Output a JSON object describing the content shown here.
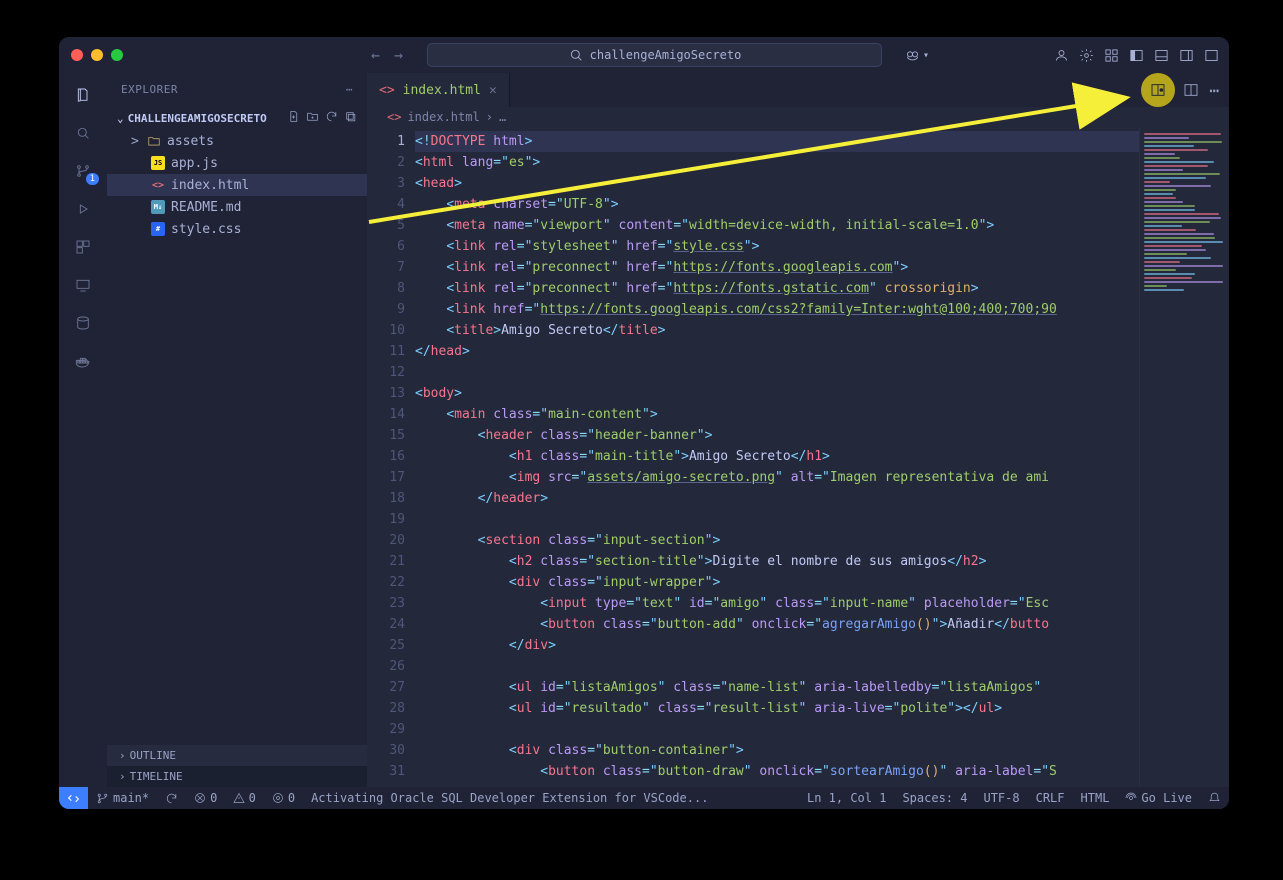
{
  "title": "challengeAmigoSecreto",
  "traffic": [
    "close",
    "min",
    "zoom"
  ],
  "sidebar": {
    "header": "EXPLORER",
    "project": "CHALLENGEAMIGOSECRETO",
    "tree": [
      {
        "kind": "folder",
        "chev": ">",
        "label": "assets",
        "icon": "folder"
      },
      {
        "kind": "file",
        "label": "app.js",
        "icon": "js"
      },
      {
        "kind": "file",
        "label": "index.html",
        "icon": "html",
        "selected": true
      },
      {
        "kind": "file",
        "label": "README.md",
        "icon": "md"
      },
      {
        "kind": "file",
        "label": "style.css",
        "icon": "css"
      }
    ],
    "outline": "OUTLINE",
    "timeline": "TIMELINE"
  },
  "tab": {
    "label": "index.html"
  },
  "breadcrumb": [
    "index.html",
    "…"
  ],
  "activity_badge": "1",
  "code_lines_count": 31,
  "code": [
    {
      "hl": true,
      "tokens": [
        [
          "p",
          "<!"
        ],
        [
          "t",
          "DOCTYPE"
        ],
        [
          "txt",
          " "
        ],
        [
          "a",
          "html"
        ],
        [
          "p",
          ">"
        ]
      ]
    },
    {
      "tokens": [
        [
          "p",
          "<"
        ],
        [
          "t",
          "html"
        ],
        [
          "txt",
          " "
        ],
        [
          "a",
          "lang"
        ],
        [
          "op",
          "="
        ],
        [
          "p",
          "\""
        ],
        [
          "s",
          "es"
        ],
        [
          "p",
          "\""
        ],
        [
          "p",
          ">"
        ]
      ]
    },
    {
      "tokens": [
        [
          "p",
          "<"
        ],
        [
          "t",
          "head"
        ],
        [
          "p",
          ">"
        ]
      ]
    },
    {
      "indent": 1,
      "tokens": [
        [
          "p",
          "<"
        ],
        [
          "t",
          "meta"
        ],
        [
          "txt",
          " "
        ],
        [
          "a",
          "charset"
        ],
        [
          "op",
          "="
        ],
        [
          "p",
          "\""
        ],
        [
          "s",
          "UTF-8"
        ],
        [
          "p",
          "\""
        ],
        [
          "p",
          ">"
        ]
      ]
    },
    {
      "indent": 1,
      "tokens": [
        [
          "p",
          "<"
        ],
        [
          "t",
          "meta"
        ],
        [
          "txt",
          " "
        ],
        [
          "a",
          "name"
        ],
        [
          "op",
          "="
        ],
        [
          "p",
          "\""
        ],
        [
          "s",
          "viewport"
        ],
        [
          "p",
          "\""
        ],
        [
          "txt",
          " "
        ],
        [
          "a",
          "content"
        ],
        [
          "op",
          "="
        ],
        [
          "p",
          "\""
        ],
        [
          "s",
          "width=device-width, initial-scale=1.0"
        ],
        [
          "p",
          "\""
        ],
        [
          "p",
          ">"
        ]
      ]
    },
    {
      "indent": 1,
      "tokens": [
        [
          "p",
          "<"
        ],
        [
          "t",
          "link"
        ],
        [
          "txt",
          " "
        ],
        [
          "a",
          "rel"
        ],
        [
          "op",
          "="
        ],
        [
          "p",
          "\""
        ],
        [
          "s",
          "stylesheet"
        ],
        [
          "p",
          "\""
        ],
        [
          "txt",
          " "
        ],
        [
          "a",
          "href"
        ],
        [
          "op",
          "="
        ],
        [
          "p",
          "\""
        ],
        [
          "su",
          "style.css"
        ],
        [
          "p",
          "\""
        ],
        [
          "p",
          ">"
        ]
      ]
    },
    {
      "indent": 1,
      "tokens": [
        [
          "p",
          "<"
        ],
        [
          "t",
          "link"
        ],
        [
          "txt",
          " "
        ],
        [
          "a",
          "rel"
        ],
        [
          "op",
          "="
        ],
        [
          "p",
          "\""
        ],
        [
          "s",
          "preconnect"
        ],
        [
          "p",
          "\""
        ],
        [
          "txt",
          " "
        ],
        [
          "a",
          "href"
        ],
        [
          "op",
          "="
        ],
        [
          "p",
          "\""
        ],
        [
          "su",
          "https://fonts.googleapis.com"
        ],
        [
          "p",
          "\""
        ],
        [
          "p",
          ">"
        ]
      ]
    },
    {
      "indent": 1,
      "tokens": [
        [
          "p",
          "<"
        ],
        [
          "t",
          "link"
        ],
        [
          "txt",
          " "
        ],
        [
          "a",
          "rel"
        ],
        [
          "op",
          "="
        ],
        [
          "p",
          "\""
        ],
        [
          "s",
          "preconnect"
        ],
        [
          "p",
          "\""
        ],
        [
          "txt",
          " "
        ],
        [
          "a",
          "href"
        ],
        [
          "op",
          "="
        ],
        [
          "p",
          "\""
        ],
        [
          "su",
          "https://fonts.gstatic.com"
        ],
        [
          "p",
          "\""
        ],
        [
          "txt",
          " "
        ],
        [
          "c",
          "crossorigin"
        ],
        [
          "p",
          ">"
        ]
      ]
    },
    {
      "indent": 1,
      "tokens": [
        [
          "p",
          "<"
        ],
        [
          "t",
          "link"
        ],
        [
          "txt",
          " "
        ],
        [
          "a",
          "href"
        ],
        [
          "op",
          "="
        ],
        [
          "p",
          "\""
        ],
        [
          "su",
          "https://fonts.googleapis.com/css2?family=Inter:wght@100;400;700;90"
        ]
      ]
    },
    {
      "indent": 1,
      "tokens": [
        [
          "p",
          "<"
        ],
        [
          "t",
          "title"
        ],
        [
          "p",
          ">"
        ],
        [
          "txt",
          "Amigo Secreto"
        ],
        [
          "p",
          "</"
        ],
        [
          "t",
          "title"
        ],
        [
          "p",
          ">"
        ]
      ]
    },
    {
      "tokens": [
        [
          "p",
          "</"
        ],
        [
          "t",
          "head"
        ],
        [
          "p",
          ">"
        ]
      ]
    },
    {
      "tokens": []
    },
    {
      "tokens": [
        [
          "p",
          "<"
        ],
        [
          "t",
          "body"
        ],
        [
          "p",
          ">"
        ]
      ]
    },
    {
      "indent": 1,
      "tokens": [
        [
          "p",
          "<"
        ],
        [
          "t",
          "main"
        ],
        [
          "txt",
          " "
        ],
        [
          "a",
          "class"
        ],
        [
          "op",
          "="
        ],
        [
          "p",
          "\""
        ],
        [
          "s",
          "main-content"
        ],
        [
          "p",
          "\""
        ],
        [
          "p",
          ">"
        ]
      ]
    },
    {
      "indent": 2,
      "tokens": [
        [
          "p",
          "<"
        ],
        [
          "t",
          "header"
        ],
        [
          "txt",
          " "
        ],
        [
          "a",
          "class"
        ],
        [
          "op",
          "="
        ],
        [
          "p",
          "\""
        ],
        [
          "s",
          "header-banner"
        ],
        [
          "p",
          "\""
        ],
        [
          "p",
          ">"
        ]
      ]
    },
    {
      "indent": 3,
      "tokens": [
        [
          "p",
          "<"
        ],
        [
          "t",
          "h1"
        ],
        [
          "txt",
          " "
        ],
        [
          "a",
          "class"
        ],
        [
          "op",
          "="
        ],
        [
          "p",
          "\""
        ],
        [
          "s",
          "main-title"
        ],
        [
          "p",
          "\""
        ],
        [
          "p",
          ">"
        ],
        [
          "txt",
          "Amigo Secreto"
        ],
        [
          "p",
          "</"
        ],
        [
          "t",
          "h1"
        ],
        [
          "p",
          ">"
        ]
      ]
    },
    {
      "indent": 3,
      "tokens": [
        [
          "p",
          "<"
        ],
        [
          "t",
          "img"
        ],
        [
          "txt",
          " "
        ],
        [
          "a",
          "src"
        ],
        [
          "op",
          "="
        ],
        [
          "p",
          "\""
        ],
        [
          "su",
          "assets/amigo-secreto.png"
        ],
        [
          "p",
          "\""
        ],
        [
          "txt",
          " "
        ],
        [
          "a",
          "alt"
        ],
        [
          "op",
          "="
        ],
        [
          "p",
          "\""
        ],
        [
          "s",
          "Imagen representativa de ami"
        ]
      ]
    },
    {
      "indent": 2,
      "tokens": [
        [
          "p",
          "</"
        ],
        [
          "t",
          "header"
        ],
        [
          "p",
          ">"
        ]
      ]
    },
    {
      "tokens": []
    },
    {
      "indent": 2,
      "tokens": [
        [
          "p",
          "<"
        ],
        [
          "t",
          "section"
        ],
        [
          "txt",
          " "
        ],
        [
          "a",
          "class"
        ],
        [
          "op",
          "="
        ],
        [
          "p",
          "\""
        ],
        [
          "s",
          "input-section"
        ],
        [
          "p",
          "\""
        ],
        [
          "p",
          ">"
        ]
      ]
    },
    {
      "indent": 3,
      "tokens": [
        [
          "p",
          "<"
        ],
        [
          "t",
          "h2"
        ],
        [
          "txt",
          " "
        ],
        [
          "a",
          "class"
        ],
        [
          "op",
          "="
        ],
        [
          "p",
          "\""
        ],
        [
          "s",
          "section-title"
        ],
        [
          "p",
          "\""
        ],
        [
          "p",
          ">"
        ],
        [
          "txt",
          "Digite el nombre de sus amigos"
        ],
        [
          "p",
          "</"
        ],
        [
          "t",
          "h2"
        ],
        [
          "p",
          ">"
        ]
      ]
    },
    {
      "indent": 3,
      "tokens": [
        [
          "p",
          "<"
        ],
        [
          "t",
          "div"
        ],
        [
          "txt",
          " "
        ],
        [
          "a",
          "class"
        ],
        [
          "op",
          "="
        ],
        [
          "p",
          "\""
        ],
        [
          "s",
          "input-wrapper"
        ],
        [
          "p",
          "\""
        ],
        [
          "p",
          ">"
        ]
      ]
    },
    {
      "indent": 4,
      "tokens": [
        [
          "p",
          "<"
        ],
        [
          "t",
          "input"
        ],
        [
          "txt",
          " "
        ],
        [
          "a",
          "type"
        ],
        [
          "op",
          "="
        ],
        [
          "p",
          "\""
        ],
        [
          "s",
          "text"
        ],
        [
          "p",
          "\""
        ],
        [
          "txt",
          " "
        ],
        [
          "a",
          "id"
        ],
        [
          "op",
          "="
        ],
        [
          "p",
          "\""
        ],
        [
          "s",
          "amigo"
        ],
        [
          "p",
          "\""
        ],
        [
          "txt",
          " "
        ],
        [
          "a",
          "class"
        ],
        [
          "op",
          "="
        ],
        [
          "p",
          "\""
        ],
        [
          "s",
          "input-name"
        ],
        [
          "p",
          "\""
        ],
        [
          "txt",
          " "
        ],
        [
          "a",
          "placeholder"
        ],
        [
          "op",
          "="
        ],
        [
          "p",
          "\""
        ],
        [
          "s",
          "Esc"
        ]
      ]
    },
    {
      "indent": 4,
      "tokens": [
        [
          "p",
          "<"
        ],
        [
          "t",
          "button"
        ],
        [
          "txt",
          " "
        ],
        [
          "a",
          "class"
        ],
        [
          "op",
          "="
        ],
        [
          "p",
          "\""
        ],
        [
          "s",
          "button-add"
        ],
        [
          "p",
          "\""
        ],
        [
          "txt",
          " "
        ],
        [
          "a",
          "onclick"
        ],
        [
          "op",
          "="
        ],
        [
          "p",
          "\""
        ],
        [
          "fn",
          "agregarAmigo"
        ],
        [
          "c",
          "()"
        ],
        [
          "p",
          "\""
        ],
        [
          "p",
          ">"
        ],
        [
          "txt",
          "Añadir"
        ],
        [
          "p",
          "</"
        ],
        [
          "t",
          "butto"
        ]
      ]
    },
    {
      "indent": 3,
      "tokens": [
        [
          "p",
          "</"
        ],
        [
          "t",
          "div"
        ],
        [
          "p",
          ">"
        ]
      ]
    },
    {
      "tokens": []
    },
    {
      "indent": 3,
      "tokens": [
        [
          "p",
          "<"
        ],
        [
          "t",
          "ul"
        ],
        [
          "txt",
          " "
        ],
        [
          "a",
          "id"
        ],
        [
          "op",
          "="
        ],
        [
          "p",
          "\""
        ],
        [
          "s",
          "listaAmigos"
        ],
        [
          "p",
          "\""
        ],
        [
          "txt",
          " "
        ],
        [
          "a",
          "class"
        ],
        [
          "op",
          "="
        ],
        [
          "p",
          "\""
        ],
        [
          "s",
          "name-list"
        ],
        [
          "p",
          "\""
        ],
        [
          "txt",
          " "
        ],
        [
          "a",
          "aria-labelledby"
        ],
        [
          "op",
          "="
        ],
        [
          "p",
          "\""
        ],
        [
          "s",
          "listaAmigos"
        ],
        [
          "p",
          "\""
        ]
      ]
    },
    {
      "indent": 3,
      "tokens": [
        [
          "p",
          "<"
        ],
        [
          "t",
          "ul"
        ],
        [
          "txt",
          " "
        ],
        [
          "a",
          "id"
        ],
        [
          "op",
          "="
        ],
        [
          "p",
          "\""
        ],
        [
          "s",
          "resultado"
        ],
        [
          "p",
          "\""
        ],
        [
          "txt",
          " "
        ],
        [
          "a",
          "class"
        ],
        [
          "op",
          "="
        ],
        [
          "p",
          "\""
        ],
        [
          "s",
          "result-list"
        ],
        [
          "p",
          "\""
        ],
        [
          "txt",
          " "
        ],
        [
          "a",
          "aria-live"
        ],
        [
          "op",
          "="
        ],
        [
          "p",
          "\""
        ],
        [
          "s",
          "polite"
        ],
        [
          "p",
          "\""
        ],
        [
          "p",
          "></"
        ],
        [
          "t",
          "ul"
        ],
        [
          "p",
          ">"
        ]
      ]
    },
    {
      "tokens": []
    },
    {
      "indent": 3,
      "tokens": [
        [
          "p",
          "<"
        ],
        [
          "t",
          "div"
        ],
        [
          "txt",
          " "
        ],
        [
          "a",
          "class"
        ],
        [
          "op",
          "="
        ],
        [
          "p",
          "\""
        ],
        [
          "s",
          "button-container"
        ],
        [
          "p",
          "\""
        ],
        [
          "p",
          ">"
        ]
      ]
    },
    {
      "indent": 4,
      "tokens": [
        [
          "p",
          "<"
        ],
        [
          "t",
          "button"
        ],
        [
          "txt",
          " "
        ],
        [
          "a",
          "class"
        ],
        [
          "op",
          "="
        ],
        [
          "p",
          "\""
        ],
        [
          "s",
          "button-draw"
        ],
        [
          "p",
          "\""
        ],
        [
          "txt",
          " "
        ],
        [
          "a",
          "onclick"
        ],
        [
          "op",
          "="
        ],
        [
          "p",
          "\""
        ],
        [
          "fn",
          "sortearAmigo"
        ],
        [
          "c",
          "()"
        ],
        [
          "p",
          "\""
        ],
        [
          "txt",
          " "
        ],
        [
          "a",
          "aria-label"
        ],
        [
          "op",
          "="
        ],
        [
          "p",
          "\""
        ],
        [
          "s",
          "S"
        ]
      ]
    }
  ],
  "status": {
    "branch": "main*",
    "sync": "",
    "errors": "0",
    "warnings": "0",
    "ports": "0",
    "activating": "Activating Oracle SQL Developer Extension for VSCode...",
    "ln": "Ln 1, Col 1",
    "spaces": "Spaces: 4",
    "enc": "UTF-8",
    "eol": "CRLF",
    "lang": "HTML",
    "golive": "Go Live"
  }
}
